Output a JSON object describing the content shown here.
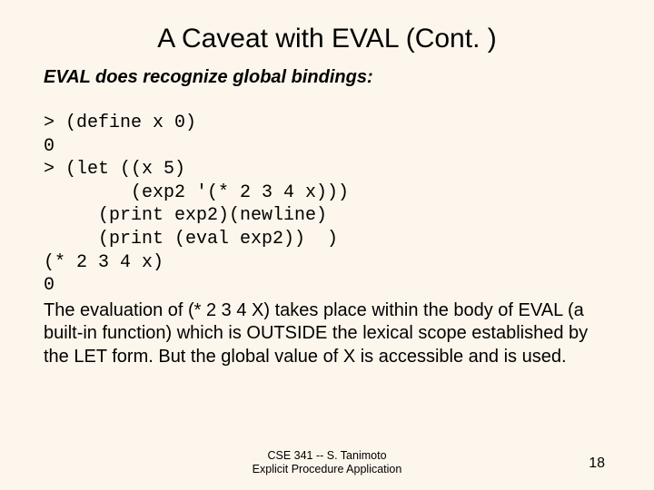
{
  "title": "A Caveat with EVAL (Cont. )",
  "subtitle": "EVAL does recognize global bindings:",
  "code": "> (define x 0)\n0\n> (let ((x 5)\n        (exp2 '(* 2 3 4 x)))\n     (print exp2)(newline)\n     (print (eval exp2))  )\n(* 2 3 4 x)\n0",
  "explain": "The evaluation of (* 2 3 4 X) takes place within the body of EVAL (a built-in function) which is OUTSIDE the lexical scope established by the LET form.\nBut the global value of X is accessible and is used.",
  "footer_line1": "CSE 341 -- S. Tanimoto",
  "footer_line2": "Explicit Procedure Application",
  "page_number": "18"
}
